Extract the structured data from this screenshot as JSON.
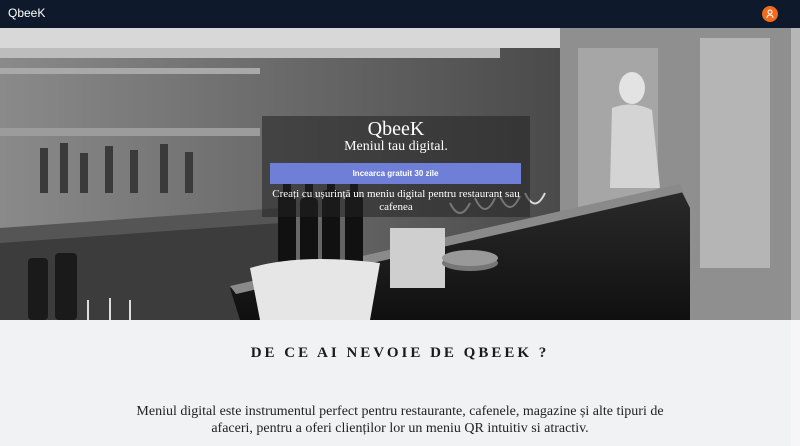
{
  "navbar": {
    "brand": "QbeeK",
    "user_icon": "user-icon",
    "accent": "#f26b1d",
    "background": "#0e1a2c"
  },
  "hero": {
    "title": "QbeeK",
    "subtitle": "Meniul tau digital.",
    "cta_label": "Incearca gratuit 30 zile",
    "description": "Creați cu ușurință un meniu digital pentru restaurant sau cafenea",
    "cta_color": "#6f7fd8"
  },
  "why": {
    "title": "DE CE AI NEVOIE DE QBEEK ?",
    "text": "Meniul digital este instrumentul perfect pentru restaurante, cafenele, magazine și alte tipuri de afaceri, pentru a oferi clienților lor un meniu QR intuitiv si atractiv."
  }
}
